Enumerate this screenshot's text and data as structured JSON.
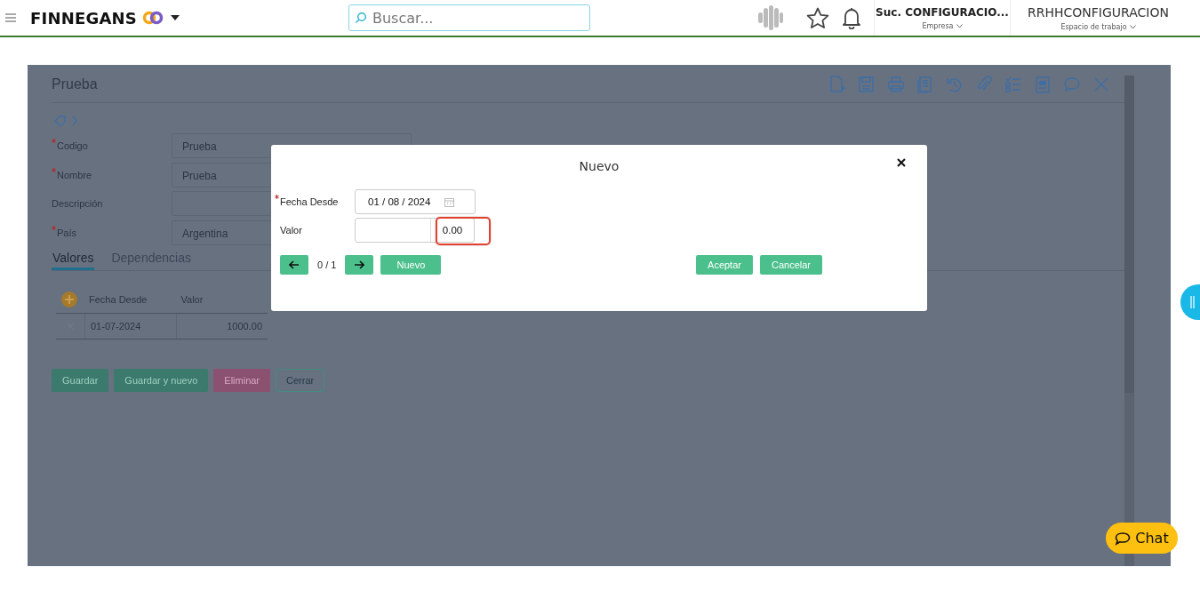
{
  "header": {
    "brand": "FINNEGANS",
    "search": {
      "placeholder": "Buscar..."
    },
    "company": {
      "name": "Suc. CONFIGURACIO...",
      "caption": "Empresa"
    },
    "workspace": {
      "name": "RRHHCONFIGURACION",
      "caption": "Espacio de trabajo"
    }
  },
  "form": {
    "title": "Prueba",
    "fields": [
      {
        "label": "Codigo",
        "required": true,
        "value": "Prueba"
      },
      {
        "label": "Nombre",
        "required": true,
        "value": "Prueba"
      },
      {
        "label": "Descripción",
        "required": false
      },
      {
        "label": "País",
        "required": true,
        "value": "Argentina"
      }
    ],
    "tabs": [
      {
        "label": "Valores",
        "selected": true
      },
      {
        "label": "Dependencias",
        "selected": false
      }
    ],
    "grid": {
      "columns": [
        "Fecha Desde",
        "Valor"
      ],
      "rows": [
        [
          "01-07-2024",
          "1000.00"
        ]
      ]
    },
    "buttons": [
      {
        "label": "Guardar",
        "kind": "primary"
      },
      {
        "label": "Guardar y nuevo",
        "kind": "primary"
      },
      {
        "label": "Eliminar",
        "kind": "danger"
      },
      {
        "label": "Cerrar",
        "kind": "outline"
      }
    ]
  },
  "dialog": {
    "title": "Nuevo",
    "fields": [
      {
        "label": "Fecha Desde",
        "required": true,
        "kind": "date",
        "value": "01 / 08 / 2024",
        "highlighted": false
      },
      {
        "label": "Valor",
        "required": false,
        "kind": "number",
        "value": "0.00",
        "highlighted": true
      }
    ],
    "pager": "0 / 1",
    "new_button": "Nuevo",
    "buttons": [
      "Aceptar",
      "Cancelar"
    ]
  },
  "chat": {
    "label": "Chat"
  }
}
